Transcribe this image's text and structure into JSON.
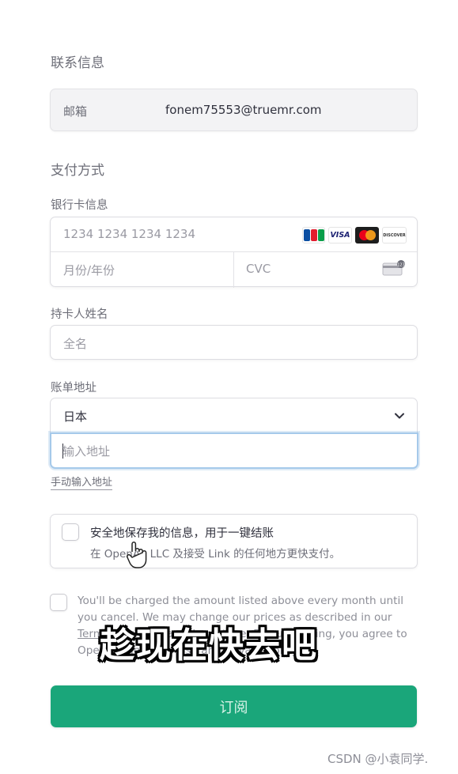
{
  "watermark_top": "",
  "contact": {
    "section_title": "联系信息",
    "email_label": "邮箱",
    "email_value": "fonem75553@truemr.com"
  },
  "payment": {
    "section_title": "支付方式",
    "card_label": "银行卡信息",
    "card_number_placeholder": "1234 1234 1234 1234",
    "expiry_placeholder": "月份/年份",
    "cvc_placeholder": "CVC",
    "card_brands": [
      "jcb-icon",
      "visa-icon",
      "mastercard-icon",
      "discover-icon"
    ],
    "brand_text": {
      "visa": "VISA",
      "discover": "DISCOVER"
    }
  },
  "cardholder": {
    "label": "持卡人姓名",
    "placeholder": "全名"
  },
  "billing": {
    "label": "账单地址",
    "country": "日本",
    "address_placeholder": "输入地址",
    "manual_link": "手动输入地址"
  },
  "link_save": {
    "title": "安全地保存我的信息，用于一键结账",
    "subtitle": "在 OpenAI, LLC 及接受 Link 的任何地方更快支付。"
  },
  "terms": {
    "text_before_link": "You'll be charged the amount listed above every month until you cancel. We may change our prices as described in our ",
    "link_text": "Terms",
    "text_after_link": ". You can cancel any time. By subscribing, you agree to OpenAI's Terms of Use and Privacy Policy."
  },
  "overlay_caption": "趁现在快去吧",
  "subscribe_button": "订阅",
  "csdn_watermark": "CSDN @小袁同学.",
  "colors": {
    "accent": "#1aa67a",
    "focus_border": "#a5c9ea",
    "muted_text": "#6d6e78"
  }
}
